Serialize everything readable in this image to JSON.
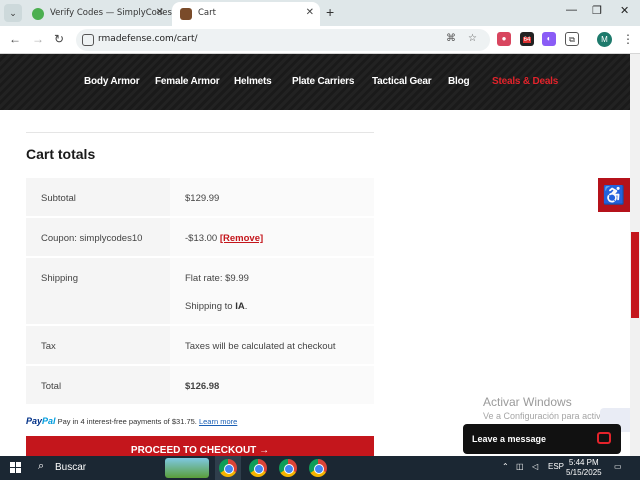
{
  "browser": {
    "tabs": [
      {
        "title": "Verify Codes — SimplyCodes",
        "active": false
      },
      {
        "title": "Cart",
        "active": true
      }
    ],
    "url": "rmadefense.com/cart/",
    "icons": {
      "tab_search": "chevron-down-icon",
      "new_tab": "plus-icon",
      "minimize": "minimize-icon",
      "restore": "restore-icon",
      "close": "close-icon",
      "back": "back-arrow-icon",
      "forward": "forward-arrow-icon",
      "reload": "reload-icon",
      "translate": "translate-icon",
      "bookmark": "star-icon",
      "extensions": "puzzle-icon",
      "menu": "kebab-menu-icon"
    },
    "extension_badge": "64",
    "profile_initial": "M"
  },
  "site_nav": {
    "items": [
      "Body Armor",
      "Female Armor",
      "Helmets",
      "Plate Carriers",
      "Tactical Gear",
      "Blog",
      "Steals & Deals"
    ],
    "highlight_color": "#e3232b"
  },
  "cart": {
    "heading": "Cart totals",
    "rows": [
      {
        "label": "Subtotal",
        "value": "$129.99"
      },
      {
        "label": "Coupon: simplycodes10",
        "value": "-$13.00",
        "action": "[Remove]"
      },
      {
        "label": "Shipping",
        "value": "Flat rate: $9.99",
        "value_line2_prefix": "Shipping to",
        "value_line2_bold": "IA",
        "value_line2_suffix": "."
      },
      {
        "label": "Tax",
        "value": "Taxes will be calculated at checkout"
      },
      {
        "label": "Total",
        "value": "$126.98"
      }
    ],
    "paypal": {
      "logo_a": "Pay",
      "logo_b": "Pal",
      "message": "Pay in 4 interest-free payments of $31.75.",
      "link": "Learn more"
    },
    "checkout_label": "PROCEED TO CHECKOUT →",
    "accent_color": "#c4161c"
  },
  "widgets": {
    "accessibility_icon": "accessibility-icon",
    "chat_label": "Leave a message",
    "chat_icon": "chat-bubble-icon"
  },
  "watermark": {
    "line1": "Activar Windows",
    "line2": "Ve a Configuración para activar Windows."
  },
  "taskbar": {
    "search_label": "Buscar",
    "language": "ESP",
    "time": "5:44 PM",
    "date": "5/15/2025"
  }
}
